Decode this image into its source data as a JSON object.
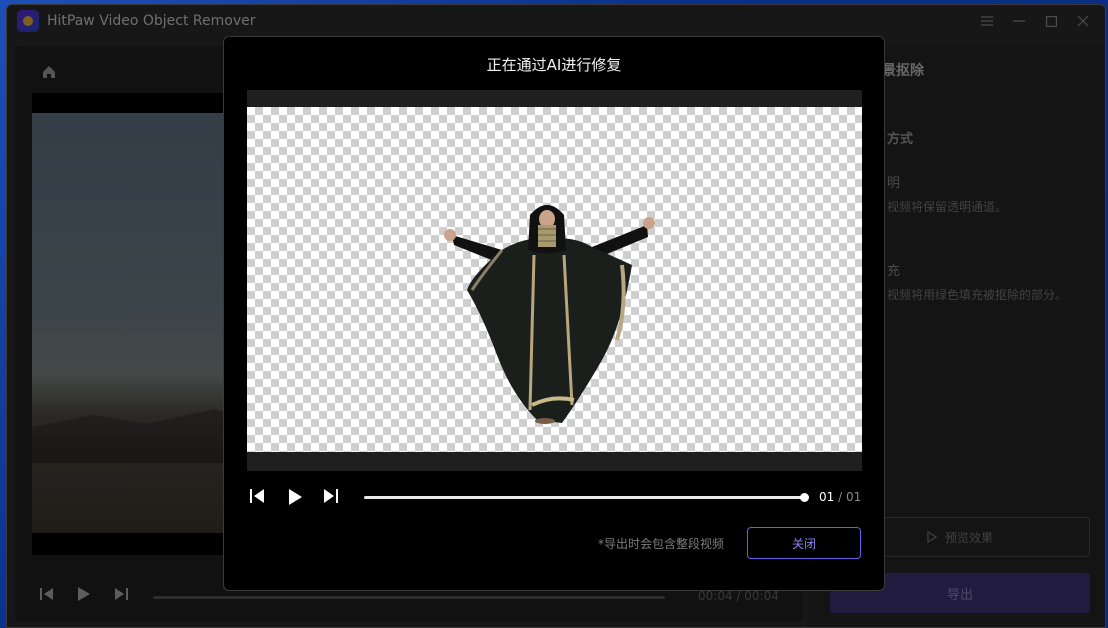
{
  "window": {
    "title": "HitPaw Video Object Remover"
  },
  "right_panel": {
    "title": "景抠除",
    "section": "方式",
    "option1_label": "明",
    "option1_desc": "视频将保留透明通道。",
    "option2_label": "充",
    "option2_desc": "视频将用绿色填充被抠除的部分。",
    "preview_label": "预览效果",
    "export_label": "导出"
  },
  "editor": {
    "time_current": "00:04",
    "time_sep": "/",
    "time_total": "00:04"
  },
  "modal": {
    "title": "正在通过AI进行修复",
    "frame_current": "01",
    "frame_sep": "/",
    "frame_total": "01",
    "note": "*导出时会包含整段视频",
    "close_label": "关闭"
  },
  "colors": {
    "accent": "#6c5ce7",
    "export_bg": "#3c3473",
    "modal_bg": "#000000"
  }
}
